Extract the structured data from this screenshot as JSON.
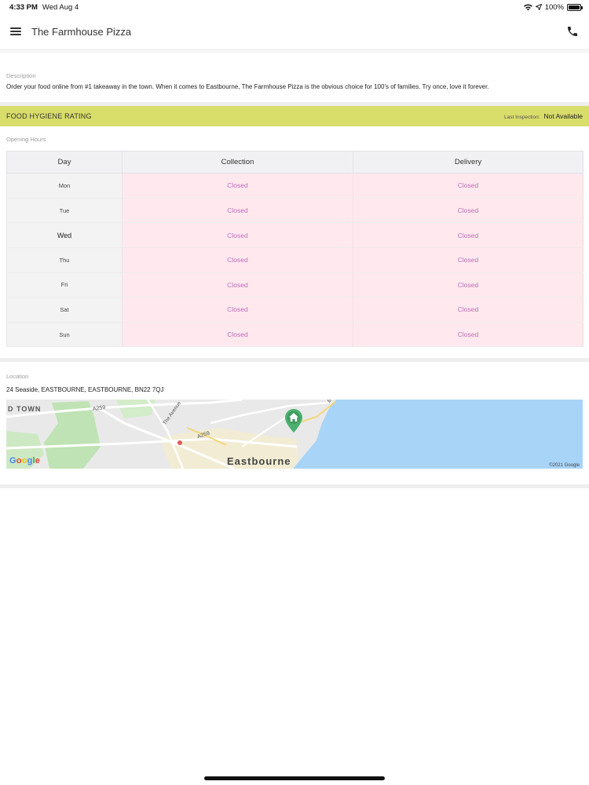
{
  "status_bar": {
    "time": "4:33 PM",
    "date": "Wed Aug 4",
    "battery": "100%",
    "icons": [
      "wifi-icon",
      "location-arrow-icon",
      "battery-icon"
    ]
  },
  "navbar": {
    "title": "The Farmhouse Pizza",
    "icons": [
      "hamburger-menu-icon",
      "phone-icon"
    ]
  },
  "description": {
    "label": "Description",
    "text": "Order your food online from #1 takeaway in the town. When it comes to Eastbourne, The Farmhouse Pizza is the obvious choice for 100's of families. Try once, love it forever."
  },
  "hygiene": {
    "title": "FOOD HYGIENE RATING",
    "inspection_label": "Last Inspection:",
    "inspection_value": "Not Available",
    "color": "#d9dd6a"
  },
  "hours": {
    "label": "Opening Hours",
    "headers": [
      "Day",
      "Collection",
      "Delivery"
    ],
    "rows": [
      {
        "day": "Mon",
        "collection": "Closed",
        "delivery": "Closed"
      },
      {
        "day": "Tue",
        "collection": "Closed",
        "delivery": "Closed"
      },
      {
        "day": "Wed",
        "collection": "Closed",
        "delivery": "Closed"
      },
      {
        "day": "Thu",
        "collection": "Closed",
        "delivery": "Closed"
      },
      {
        "day": "Fri",
        "collection": "Closed",
        "delivery": "Closed"
      },
      {
        "day": "Sat",
        "collection": "Closed",
        "delivery": "Closed"
      },
      {
        "day": "Sun",
        "collection": "Closed",
        "delivery": "Closed"
      }
    ],
    "today": "Wed",
    "closed_color": "#c06bbd"
  },
  "location": {
    "label": "Location",
    "address": "24 Seaside, EASTBOURNE, EASTBOURNE, BN22 7QJ",
    "map": {
      "town_label": "D TOWN",
      "city_label": "Eastbourne",
      "road_labels": [
        "A259",
        "The Avenue",
        "A259",
        "B"
      ],
      "logo": "Google",
      "copyright": "©2021 Google",
      "sea_color": "#a8d4f8",
      "marker_icon": "home-marker-icon"
    }
  }
}
